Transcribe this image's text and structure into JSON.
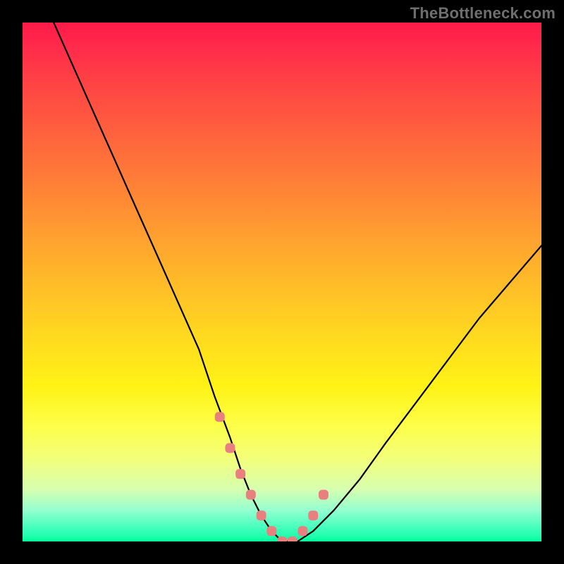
{
  "watermark": "TheBottleneck.com",
  "chart_data": {
    "type": "line",
    "title": "",
    "xlabel": "",
    "ylabel": "",
    "xlim": [
      0,
      100
    ],
    "ylim": [
      0,
      100
    ],
    "series": [
      {
        "name": "bottleneck-curve",
        "x": [
          6,
          10,
          14,
          18,
          22,
          26,
          30,
          34,
          37,
          40,
          42,
          44,
          46,
          48,
          50,
          53,
          56,
          60,
          65,
          70,
          76,
          82,
          88,
          94,
          100
        ],
        "values": [
          100,
          91,
          82,
          73,
          64,
          55,
          46,
          37,
          28,
          20,
          14,
          9,
          5,
          2,
          0,
          0,
          2,
          6,
          12,
          19,
          27,
          35,
          43,
          50,
          57
        ]
      }
    ],
    "highlight_points": {
      "name": "pink-markers",
      "color": "#e98080",
      "x": [
        38,
        40,
        42,
        44,
        46,
        48,
        50,
        52,
        54,
        56,
        58
      ],
      "values": [
        24,
        18,
        13,
        9,
        5,
        2,
        0,
        0,
        2,
        5,
        9
      ]
    },
    "gradient_meaning": "background color encodes bottleneck severity: red=high, green=low"
  }
}
